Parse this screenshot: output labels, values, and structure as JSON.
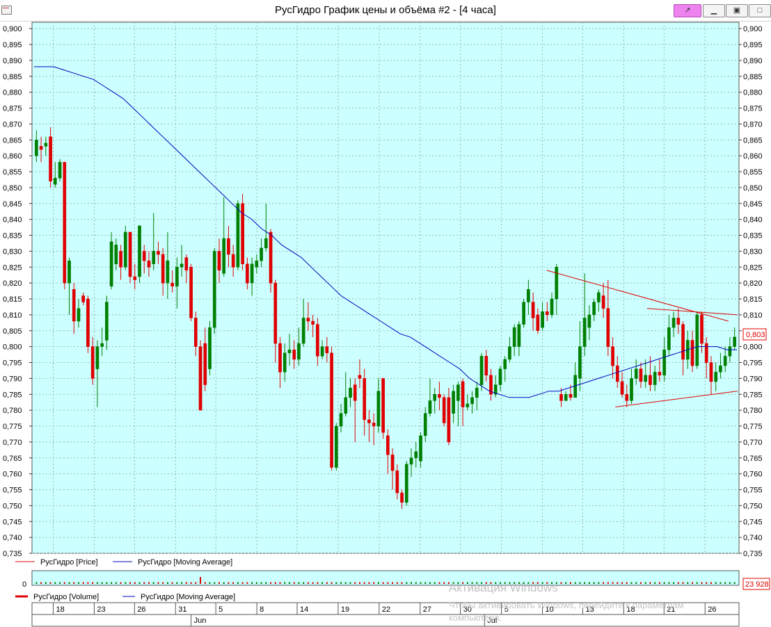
{
  "window": {
    "title": "РусГидро График цены и объёма #2 - [4 часа]",
    "pin_icon": "pin-icon",
    "min_icon": "minimize-icon",
    "max_icon": "restore-icon",
    "close_icon": "close-icon"
  },
  "colors": {
    "plot_bg": "#ccffff",
    "up": "#008000",
    "down": "#e00000",
    "ma": "#0000c0",
    "trendline": "#e00000",
    "grid": "#9db5b5"
  },
  "chart_data": [
    {
      "type": "candlestick",
      "y_ticks": [
        "0,900",
        "0,895",
        "0,890",
        "0,885",
        "0,880",
        "0,875",
        "0,870",
        "0,865",
        "0,860",
        "0,855",
        "0,850",
        "0,845",
        "0,840",
        "0,835",
        "0,830",
        "0,825",
        "0,820",
        "0,815",
        "0,810",
        "0,805",
        "0,800",
        "0,795",
        "0,790",
        "0,785",
        "0,780",
        "0,775",
        "0,770",
        "0,765",
        "0,760",
        "0,755",
        "0,750",
        "0,745",
        "0,740",
        "0,735"
      ],
      "ylim": [
        0.735,
        0.902
      ],
      "last_price_label": "0,803",
      "last_price": 0.803,
      "legend": [
        {
          "name": "РусГидро [Price]",
          "color": "#e00000"
        },
        {
          "name": "РусГидро [Moving Average]",
          "color": "#0000c0"
        }
      ],
      "candles": [
        [
          0.86,
          0.865,
          0.868,
          0.858
        ],
        [
          0.863,
          0.862,
          0.866,
          0.858
        ],
        [
          0.863,
          0.864,
          0.866,
          0.86
        ],
        [
          0.866,
          0.852,
          0.869,
          0.85
        ],
        [
          0.851,
          0.853,
          0.858,
          0.85
        ],
        [
          0.853,
          0.858,
          0.859,
          0.852
        ],
        [
          0.858,
          0.82,
          0.858,
          0.818
        ],
        [
          0.82,
          0.827,
          0.828,
          0.81
        ],
        [
          0.818,
          0.808,
          0.82,
          0.804
        ],
        [
          0.808,
          0.812,
          0.815,
          0.806
        ],
        [
          0.816,
          0.814,
          0.817,
          0.813
        ],
        [
          0.815,
          0.8,
          0.816,
          0.798
        ],
        [
          0.8,
          0.79,
          0.803,
          0.788
        ],
        [
          0.793,
          0.8,
          0.802,
          0.781
        ],
        [
          0.8,
          0.801,
          0.806,
          0.797
        ],
        [
          0.802,
          0.814,
          0.816,
          0.799
        ],
        [
          0.819,
          0.833,
          0.836,
          0.818
        ],
        [
          0.826,
          0.832,
          0.834,
          0.824
        ],
        [
          0.83,
          0.825,
          0.832,
          0.821
        ],
        [
          0.825,
          0.836,
          0.838,
          0.824
        ],
        [
          0.836,
          0.822,
          0.836,
          0.82
        ],
        [
          0.822,
          0.821,
          0.826,
          0.818
        ],
        [
          0.822,
          0.838,
          0.838,
          0.82
        ],
        [
          0.83,
          0.827,
          0.832,
          0.823
        ],
        [
          0.827,
          0.825,
          0.83,
          0.822
        ],
        [
          0.826,
          0.83,
          0.842,
          0.824
        ],
        [
          0.83,
          0.829,
          0.833,
          0.826
        ],
        [
          0.829,
          0.82,
          0.831,
          0.816
        ],
        [
          0.82,
          0.827,
          0.836,
          0.815
        ],
        [
          0.82,
          0.819,
          0.824,
          0.817
        ],
        [
          0.819,
          0.825,
          0.828,
          0.812
        ],
        [
          0.825,
          0.826,
          0.832,
          0.822
        ],
        [
          0.828,
          0.824,
          0.829,
          0.82
        ],
        [
          0.825,
          0.809,
          0.826,
          0.808
        ],
        [
          0.809,
          0.8,
          0.811,
          0.797
        ],
        [
          0.8,
          0.78,
          0.802,
          0.78
        ],
        [
          0.801,
          0.788,
          0.806,
          0.786
        ],
        [
          0.793,
          0.806,
          0.808,
          0.791
        ],
        [
          0.806,
          0.83,
          0.831,
          0.804
        ],
        [
          0.83,
          0.824,
          0.834,
          0.82
        ],
        [
          0.823,
          0.834,
          0.847,
          0.822
        ],
        [
          0.834,
          0.829,
          0.838,
          0.825
        ],
        [
          0.829,
          0.825,
          0.832,
          0.822
        ],
        [
          0.825,
          0.845,
          0.846,
          0.824
        ],
        [
          0.845,
          0.826,
          0.848,
          0.824
        ],
        [
          0.826,
          0.82,
          0.828,
          0.818
        ],
        [
          0.82,
          0.826,
          0.828,
          0.816
        ],
        [
          0.825,
          0.827,
          0.829,
          0.823
        ],
        [
          0.827,
          0.831,
          0.834,
          0.825
        ],
        [
          0.831,
          0.834,
          0.845,
          0.83
        ],
        [
          0.836,
          0.82,
          0.837,
          0.817
        ],
        [
          0.82,
          0.801,
          0.821,
          0.795
        ],
        [
          0.801,
          0.792,
          0.803,
          0.787
        ],
        [
          0.792,
          0.798,
          0.801,
          0.789
        ],
        [
          0.798,
          0.799,
          0.804,
          0.794
        ],
        [
          0.799,
          0.796,
          0.802,
          0.793
        ],
        [
          0.796,
          0.801,
          0.806,
          0.794
        ],
        [
          0.801,
          0.809,
          0.815,
          0.8
        ],
        [
          0.809,
          0.808,
          0.814,
          0.805
        ],
        [
          0.808,
          0.807,
          0.81,
          0.803
        ],
        [
          0.807,
          0.797,
          0.809,
          0.794
        ],
        [
          0.797,
          0.8,
          0.802,
          0.796
        ],
        [
          0.8,
          0.798,
          0.803,
          0.795
        ],
        [
          0.798,
          0.762,
          0.8,
          0.761
        ],
        [
          0.762,
          0.775,
          0.776,
          0.761
        ],
        [
          0.775,
          0.779,
          0.782,
          0.773
        ],
        [
          0.779,
          0.784,
          0.792,
          0.778
        ],
        [
          0.784,
          0.787,
          0.79,
          0.781
        ],
        [
          0.788,
          0.783,
          0.79,
          0.77
        ],
        [
          0.791,
          0.79,
          0.796,
          0.787
        ],
        [
          0.79,
          0.777,
          0.793,
          0.772
        ],
        [
          0.777,
          0.776,
          0.78,
          0.77
        ],
        [
          0.776,
          0.775,
          0.779,
          0.769
        ],
        [
          0.775,
          0.786,
          0.79,
          0.773
        ],
        [
          0.79,
          0.773,
          0.79,
          0.771
        ],
        [
          0.772,
          0.766,
          0.774,
          0.76
        ],
        [
          0.766,
          0.761,
          0.768,
          0.755
        ],
        [
          0.761,
          0.754,
          0.763,
          0.752
        ],
        [
          0.754,
          0.751,
          0.755,
          0.749
        ],
        [
          0.751,
          0.763,
          0.764,
          0.75
        ],
        [
          0.763,
          0.765,
          0.768,
          0.759
        ],
        [
          0.765,
          0.767,
          0.77,
          0.762
        ],
        [
          0.764,
          0.772,
          0.773,
          0.762
        ],
        [
          0.772,
          0.779,
          0.781,
          0.77
        ],
        [
          0.779,
          0.783,
          0.79,
          0.778
        ],
        [
          0.783,
          0.785,
          0.787,
          0.779
        ],
        [
          0.785,
          0.784,
          0.789,
          0.78
        ],
        [
          0.784,
          0.776,
          0.785,
          0.775
        ],
        [
          0.784,
          0.77,
          0.787,
          0.769
        ],
        [
          0.779,
          0.786,
          0.788,
          0.776
        ],
        [
          0.783,
          0.788,
          0.789,
          0.775
        ],
        [
          0.789,
          0.781,
          0.79,
          0.775
        ],
        [
          0.781,
          0.782,
          0.785,
          0.78
        ],
        [
          0.782,
          0.784,
          0.786,
          0.779
        ],
        [
          0.784,
          0.787,
          0.789,
          0.78
        ],
        [
          0.788,
          0.797,
          0.798,
          0.786
        ],
        [
          0.797,
          0.791,
          0.799,
          0.789
        ],
        [
          0.791,
          0.785,
          0.793,
          0.783
        ],
        [
          0.785,
          0.788,
          0.791,
          0.784
        ],
        [
          0.788,
          0.793,
          0.794,
          0.786
        ],
        [
          0.793,
          0.796,
          0.797,
          0.789
        ],
        [
          0.796,
          0.8,
          0.803,
          0.795
        ],
        [
          0.8,
          0.806,
          0.807,
          0.797
        ],
        [
          0.8,
          0.807,
          0.808,
          0.797
        ],
        [
          0.807,
          0.814,
          0.815,
          0.806
        ],
        [
          0.814,
          0.818,
          0.821,
          0.81
        ],
        [
          0.814,
          0.809,
          0.817,
          0.805
        ],
        [
          0.81,
          0.805,
          0.812,
          0.804
        ],
        [
          0.806,
          0.811,
          0.814,
          0.805
        ],
        [
          0.811,
          0.81,
          0.814,
          0.808
        ],
        [
          0.81,
          0.815,
          0.817,
          0.809
        ],
        [
          0.815,
          0.825,
          0.826,
          0.81
        ],
        [
          0.785,
          0.783,
          0.787,
          0.781
        ],
        [
          0.783,
          0.785,
          0.786,
          0.783
        ],
        [
          0.785,
          0.784,
          0.788,
          0.783
        ],
        [
          0.784,
          0.791,
          0.795,
          0.784
        ],
        [
          0.79,
          0.8,
          0.808,
          0.786
        ],
        [
          0.8,
          0.809,
          0.823,
          0.797
        ],
        [
          0.806,
          0.81,
          0.813,
          0.802
        ],
        [
          0.81,
          0.814,
          0.815,
          0.808
        ],
        [
          0.814,
          0.817,
          0.818,
          0.811
        ],
        [
          0.816,
          0.812,
          0.82,
          0.809
        ],
        [
          0.812,
          0.8,
          0.821,
          0.797
        ],
        [
          0.8,
          0.794,
          0.803,
          0.79
        ],
        [
          0.794,
          0.789,
          0.797,
          0.787
        ],
        [
          0.789,
          0.785,
          0.792,
          0.784
        ],
        [
          0.785,
          0.783,
          0.788,
          0.781
        ],
        [
          0.783,
          0.79,
          0.793,
          0.782
        ],
        [
          0.79,
          0.793,
          0.796,
          0.788
        ],
        [
          0.793,
          0.789,
          0.795,
          0.787
        ],
        [
          0.789,
          0.791,
          0.796,
          0.787
        ],
        [
          0.791,
          0.788,
          0.797,
          0.786
        ],
        [
          0.788,
          0.792,
          0.794,
          0.786
        ],
        [
          0.792,
          0.791,
          0.796,
          0.789
        ],
        [
          0.791,
          0.799,
          0.803,
          0.789
        ],
        [
          0.799,
          0.806,
          0.81,
          0.797
        ],
        [
          0.806,
          0.809,
          0.811,
          0.803
        ],
        [
          0.809,
          0.807,
          0.812,
          0.804
        ],
        [
          0.807,
          0.796,
          0.808,
          0.791
        ],
        [
          0.796,
          0.802,
          0.805,
          0.793
        ],
        [
          0.802,
          0.794,
          0.805,
          0.792
        ],
        [
          0.794,
          0.81,
          0.811,
          0.793
        ],
        [
          0.81,
          0.801,
          0.811,
          0.798
        ],
        [
          0.801,
          0.795,
          0.803,
          0.79
        ],
        [
          0.795,
          0.789,
          0.797,
          0.785
        ],
        [
          0.789,
          0.792,
          0.795,
          0.786
        ],
        [
          0.792,
          0.794,
          0.798,
          0.79
        ],
        [
          0.794,
          0.797,
          0.8,
          0.792
        ],
        [
          0.797,
          0.8,
          0.803,
          0.795
        ],
        [
          0.8,
          0.803,
          0.806,
          0.799
        ]
      ],
      "ma": [
        0.888,
        0.888,
        0.888,
        0.887,
        0.886,
        0.885,
        0.884,
        0.882,
        0.88,
        0.878,
        0.875,
        0.872,
        0.869,
        0.866,
        0.863,
        0.86,
        0.857,
        0.854,
        0.851,
        0.848,
        0.845,
        0.842,
        0.84,
        0.837,
        0.835,
        0.832,
        0.83,
        0.828,
        0.825,
        0.822,
        0.819,
        0.816,
        0.814,
        0.812,
        0.81,
        0.808,
        0.806,
        0.804,
        0.803,
        0.801,
        0.799,
        0.797,
        0.795,
        0.793,
        0.79,
        0.788,
        0.786,
        0.785,
        0.784,
        0.784,
        0.784,
        0.785,
        0.786,
        0.786,
        0.787,
        0.788,
        0.789,
        0.79,
        0.791,
        0.792,
        0.793,
        0.794,
        0.795,
        0.796,
        0.797,
        0.798,
        0.799,
        0.8,
        0.8,
        0.8,
        0.799,
        0.799
      ],
      "trendlines": [
        {
          "x0": 0.728,
          "y0": 0.824,
          "x1": 0.985,
          "y1": 0.808
        },
        {
          "x0": 0.87,
          "y0": 0.812,
          "x1": 0.998,
          "y1": 0.81
        },
        {
          "x0": 0.825,
          "y0": 0.781,
          "x1": 0.998,
          "y1": 0.786
        }
      ]
    },
    {
      "type": "bar",
      "y_ticks": [
        "0"
      ],
      "last_value_label": "23 928",
      "legend": [
        {
          "name": "РусГидро [Volume]",
          "color": "#e00000"
        },
        {
          "name": "РусГидро [Moving Average]",
          "color": "#0000c0"
        }
      ]
    }
  ],
  "x_axis": {
    "day_labels": [
      "18",
      "23",
      "26",
      "31",
      "5",
      "8",
      "14",
      "19",
      "22",
      "27",
      "30",
      "5",
      "10",
      "13",
      "18",
      "21",
      "26"
    ],
    "month_labels": [
      "Jun",
      "Jul"
    ]
  },
  "watermark": {
    "line1": "Активация Windows",
    "line2": "Чтобы активировать Windows, перейдите к параметрам компьютера."
  }
}
